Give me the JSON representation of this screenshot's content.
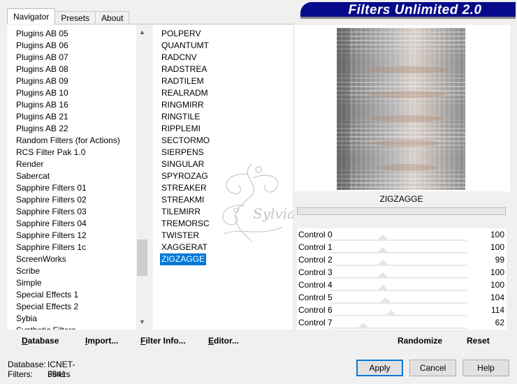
{
  "tabs": [
    "Navigator",
    "Presets",
    "About"
  ],
  "title": "Filters Unlimited 2.0",
  "categories": [
    "Plugins AB 05",
    "Plugins AB 06",
    "Plugins AB 07",
    "Plugins AB 08",
    "Plugins AB 09",
    "Plugins AB 10",
    "Plugins AB 16",
    "Plugins AB 21",
    "Plugins AB 22",
    "Random Filters (for Actions)",
    "RCS Filter Pak 1.0",
    "Render",
    "Sabercat",
    "Sapphire Filters 01",
    "Sapphire Filters 02",
    "Sapphire Filters 03",
    "Sapphire Filters 04",
    "Sapphire Filters 12",
    "Sapphire Filters 1c",
    "ScreenWorks",
    "Scribe",
    "Simple",
    "Special Effects 1",
    "Special Effects 2",
    "Sybia",
    "Synthetic Filters"
  ],
  "filters": [
    "POLPERV",
    "QUANTUMT",
    "RADCNV",
    "RADSTREA",
    "RADTILEM",
    "REALRADM",
    "RINGMIRR",
    "RINGTILE",
    "RIPPLEMI",
    "SECTORMO",
    "SIERPENS",
    "SINGULAR",
    "SPYROZAG",
    "STREAKER",
    "STREAKMI",
    "TILEMIRR",
    "TREMORSC",
    "TWISTER",
    "XAGGERAT",
    "ZIGZAGGE"
  ],
  "selected_filter": "ZIGZAGGE",
  "filter_name": "ZIGZAGGE",
  "controls": [
    {
      "label": "Control 0",
      "value": "100",
      "level": 0.39
    },
    {
      "label": "Control 1",
      "value": "100",
      "level": 0.39
    },
    {
      "label": "Control 2",
      "value": "99",
      "level": 0.388
    },
    {
      "label": "Control 3",
      "value": "100",
      "level": 0.39
    },
    {
      "label": "Control 4",
      "value": "100",
      "level": 0.39
    },
    {
      "label": "Control 5",
      "value": "104",
      "level": 0.408
    },
    {
      "label": "Control 6",
      "value": "114",
      "level": 0.447
    },
    {
      "label": "Control 7",
      "value": "62",
      "level": 0.243
    }
  ],
  "buttons": {
    "database": "Database",
    "import": "Import...",
    "filter_info": "Filter Info...",
    "editor": "Editor...",
    "randomize": "Randomize",
    "reset": "Reset",
    "apply": "Apply",
    "cancel": "Cancel",
    "help": "Help"
  },
  "status": {
    "database_label": "Database:",
    "database_value": "ICNET-Filters",
    "filters_label": "Filters:",
    "filters_value": "3541"
  },
  "watermark_text": "Sylviane",
  "colors": {
    "selection": "#0078d7",
    "banner": "#060a8a"
  },
  "icons": {
    "scroll_up": "scroll-up-arrow-icon",
    "scroll_down": "scroll-down-arrow-icon"
  }
}
